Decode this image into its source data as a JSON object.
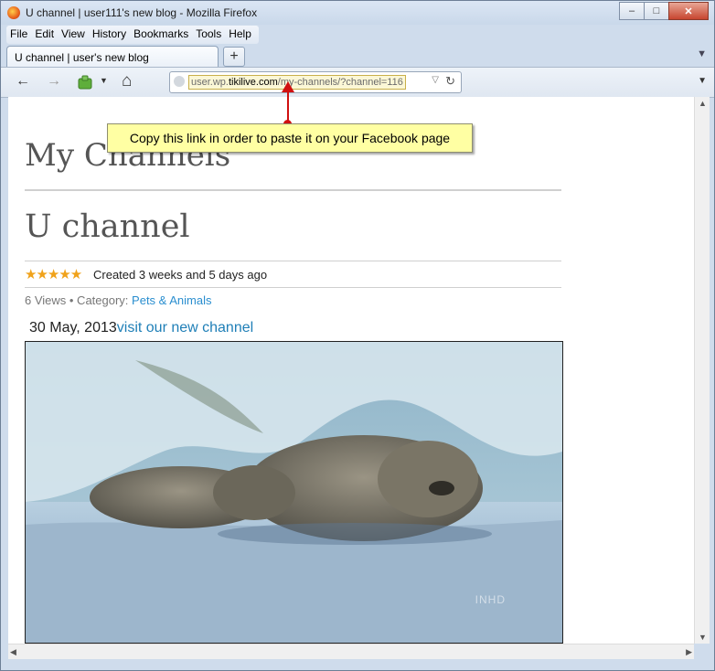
{
  "window": {
    "title": "U channel | user111's new blog - Mozilla Firefox",
    "minimize": "–",
    "maximize": "□",
    "close": "✕"
  },
  "menubar": {
    "items": [
      "File",
      "Edit",
      "View",
      "History",
      "Bookmarks",
      "Tools",
      "Help"
    ]
  },
  "tabs": {
    "active_label": "U channel | user's new blog",
    "new_tab": "+",
    "list_all": "▼"
  },
  "navbar": {
    "url_prefix": "user.wp.",
    "url_domain": "tikilive.com",
    "url_path": "/my-channels/?channel=116",
    "back": "←",
    "forward": "→",
    "home": "⌂",
    "reload": "↻",
    "dropdown": "▽",
    "menu": "▼"
  },
  "callout": {
    "text": "Copy this link in order to paste it on your Facebook page"
  },
  "page": {
    "heading": "My Channels",
    "channel_title": "U channel",
    "stars": "★★★★★",
    "rating": 5,
    "created": "Created 3 weeks and 5 days ago",
    "views": "6 Views • Category: ",
    "category": "Pets & Animals",
    "post_date": "30 May, 2013",
    "post_link": "visit our new channel",
    "video_watermark": "INHD"
  },
  "icons": [
    "firefox-logo-icon",
    "back-arrow-icon",
    "forward-arrow-icon",
    "bookmark-icon",
    "home-icon",
    "site-identity-icon",
    "reload-icon"
  ],
  "colors": {
    "link": "#1f7fb7",
    "star": "#f0a21a",
    "callout_bg": "#ffffa3",
    "annotation_arrow": "#d01010"
  }
}
